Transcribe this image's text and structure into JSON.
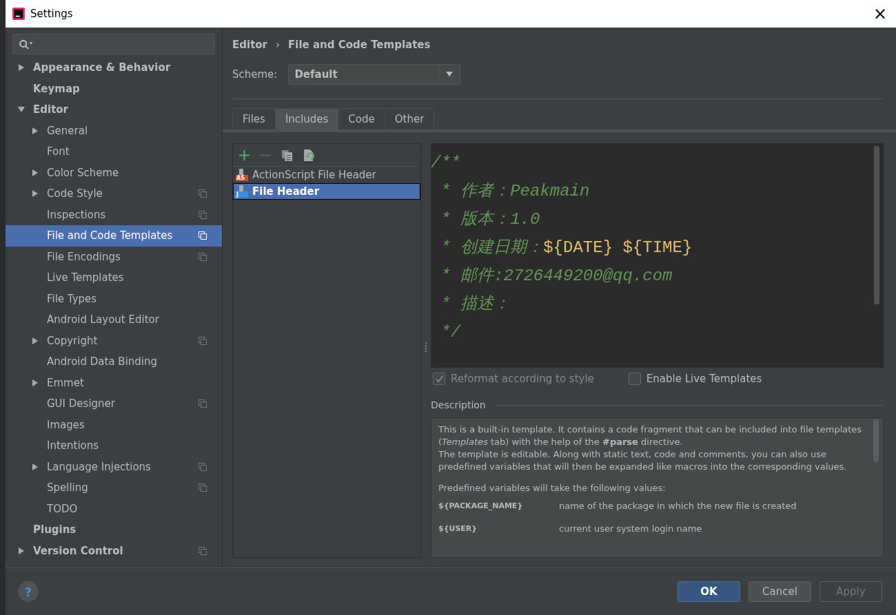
{
  "window": {
    "title": "Settings",
    "close": "×"
  },
  "sidebar": {
    "items": [
      {
        "label": "Appearance & Behavior",
        "expanded": false,
        "shared": false
      },
      {
        "label": "Keymap",
        "shared": false
      },
      {
        "label": "Editor",
        "expanded": true,
        "shared": false,
        "children": [
          {
            "label": "General",
            "expanded": false,
            "shared": false,
            "selected": false
          },
          {
            "label": "Font",
            "shared": false,
            "selected": false
          },
          {
            "label": "Color Scheme",
            "expanded": false,
            "shared": false,
            "selected": false
          },
          {
            "label": "Code Style",
            "expanded": false,
            "shared": true,
            "selected": false
          },
          {
            "label": "Inspections",
            "shared": true,
            "selected": false
          },
          {
            "label": "File and Code Templates",
            "shared": true,
            "selected": true
          },
          {
            "label": "File Encodings",
            "shared": true,
            "selected": false
          },
          {
            "label": "Live Templates",
            "shared": false,
            "selected": false
          },
          {
            "label": "File Types",
            "shared": false,
            "selected": false
          },
          {
            "label": "Android Layout Editor",
            "shared": false,
            "selected": false
          },
          {
            "label": "Copyright",
            "expanded": false,
            "shared": true,
            "selected": false
          },
          {
            "label": "Android Data Binding",
            "shared": false,
            "selected": false
          },
          {
            "label": "Emmet",
            "expanded": false,
            "shared": false,
            "selected": false
          },
          {
            "label": "GUI Designer",
            "shared": true,
            "selected": false
          },
          {
            "label": "Images",
            "shared": false,
            "selected": false
          },
          {
            "label": "Intentions",
            "shared": false,
            "selected": false
          },
          {
            "label": "Language Injections",
            "expanded": false,
            "shared": true,
            "selected": false
          },
          {
            "label": "Spelling",
            "shared": true,
            "selected": false
          },
          {
            "label": "TODO",
            "shared": false,
            "selected": false
          }
        ]
      },
      {
        "label": "Plugins",
        "shared": false
      },
      {
        "label": "Version Control",
        "expanded": false,
        "shared": true
      }
    ]
  },
  "breadcrumb": {
    "parent": "Editor",
    "separator": "›",
    "current": "File and Code Templates"
  },
  "scheme": {
    "label": "Scheme:",
    "value": "Default"
  },
  "tabs": [
    {
      "label": "Files",
      "selected": false
    },
    {
      "label": "Includes",
      "selected": true
    },
    {
      "label": "Code",
      "selected": false
    },
    {
      "label": "Other",
      "selected": false
    }
  ],
  "templates": [
    {
      "label": "ActionScript File Header",
      "badge": "AS",
      "color": "#c9562a",
      "selected": false
    },
    {
      "label": "File Header",
      "badge": "J",
      "color": "#3d8fd6",
      "selected": true
    }
  ],
  "editor": {
    "lines": [
      [
        {
          "text": "/**",
          "kind": "comment"
        }
      ],
      [
        {
          "text": " * 作者：Peakmain",
          "kind": "comment"
        }
      ],
      [
        {
          "text": " * 版本：1.0",
          "kind": "comment"
        }
      ],
      [
        {
          "text": " * 创建日期：",
          "kind": "comment"
        },
        {
          "text": "${DATE}",
          "kind": "macro"
        },
        {
          "text": "${TIME}",
          "kind": "macro"
        }
      ],
      [
        {
          "text": " * 邮件:2726449200@qq.com",
          "kind": "comment"
        }
      ],
      [
        {
          "text": " * 描述：",
          "kind": "comment"
        }
      ],
      [
        {
          "text": " */",
          "kind": "comment"
        }
      ]
    ]
  },
  "options": [
    {
      "label": "Reformat according to style",
      "checked": true,
      "disabled": true
    },
    {
      "label": "Enable Live Templates",
      "checked": false,
      "disabled": false
    }
  ],
  "description": {
    "title": "Description",
    "paragraphs": [
      "This is a built-in template. It contains a code fragment that can be included into file templates (*Templates* tab) with the help of the **#parse** directive.",
      "The template is editable. Along with static text, code and comments, you can also use predefined variables that will then be expanded like macros into the corresponding values."
    ],
    "intro": "Predefined variables will take the following values:",
    "variables": [
      {
        "name": "${PACKAGE_NAME}",
        "meaning": "name of the package in which the new file is created"
      },
      {
        "name": "${USER}",
        "meaning": "current user system login name"
      }
    ]
  },
  "buttons": [
    {
      "label": "OK",
      "kind": "default",
      "disabled": false
    },
    {
      "label": "Cancel",
      "kind": "normal",
      "disabled": false
    },
    {
      "label": "Apply",
      "kind": "normal",
      "disabled": true
    }
  ],
  "help": "?"
}
